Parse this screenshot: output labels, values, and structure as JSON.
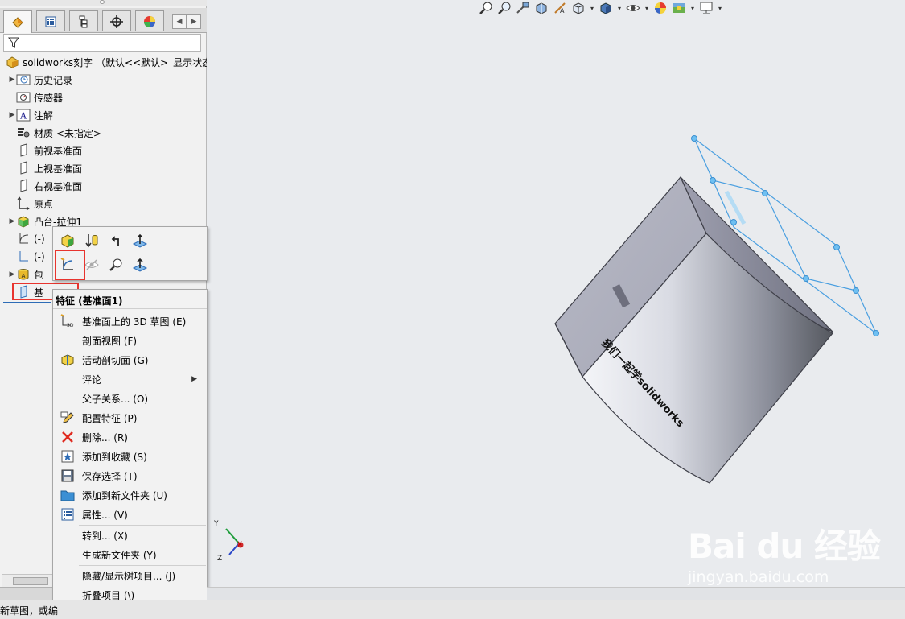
{
  "feature_tree": {
    "root_label": "solidworks刻字 （默认<<默认>_显示状态",
    "items": [
      {
        "label": "历史记录",
        "icon": "history-icon",
        "expandable": true
      },
      {
        "label": "传感器",
        "icon": "sensor-icon",
        "expandable": false
      },
      {
        "label": "注解",
        "icon": "annotation-icon",
        "expandable": true
      },
      {
        "label": "材质 <未指定>",
        "icon": "material-icon",
        "expandable": false
      },
      {
        "label": "前视基准面",
        "icon": "plane-icon",
        "expandable": false
      },
      {
        "label": "上视基准面",
        "icon": "plane-icon",
        "expandable": false
      },
      {
        "label": "右视基准面",
        "icon": "plane-icon",
        "expandable": false
      },
      {
        "label": "原点",
        "icon": "origin-icon",
        "expandable": false
      },
      {
        "label": "凸台-拉伸1",
        "icon": "boss-extrude-icon",
        "expandable": true
      },
      {
        "label": "(-)",
        "icon": "sketch-icon",
        "expandable": false
      },
      {
        "label": "(-)",
        "icon": "sketch-icon",
        "expandable": false
      },
      {
        "label": "包",
        "icon": "wrap-icon",
        "expandable": true
      },
      {
        "label": "基",
        "icon": "plane-icon",
        "expandable": false
      }
    ]
  },
  "context_menu": {
    "header": "特征 (基准面1)",
    "items": [
      {
        "label": "基准面上的 3D 草图 (E)",
        "icon": "3d-sketch-icon"
      },
      {
        "label": "剖面视图 (F)",
        "icon": ""
      },
      {
        "label": "活动剖切面 (G)",
        "icon": "section-plane-icon"
      },
      {
        "label": "评论",
        "icon": "",
        "submenu": true
      },
      {
        "label": "父子关系... (O)",
        "icon": ""
      },
      {
        "label": "配置特征 (P)",
        "icon": "pencil-icon"
      },
      {
        "label": "删除... (R)",
        "icon": "delete-icon"
      },
      {
        "label": "添加到收藏 (S)",
        "icon": "favorite-icon"
      },
      {
        "label": "保存选择 (T)",
        "icon": "save-selection-icon"
      },
      {
        "label": "添加到新文件夹 (U)",
        "icon": "folder-icon"
      },
      {
        "label": "属性... (V)",
        "icon": "properties-icon"
      },
      {
        "label": "转到... (X)",
        "icon": ""
      },
      {
        "label": "生成新文件夹 (Y)",
        "icon": ""
      },
      {
        "label": "隐藏/显示树项目... (J)",
        "icon": ""
      },
      {
        "label": "折叠项目 (\\)",
        "icon": ""
      }
    ]
  },
  "model": {
    "engraved_text": "我们一起学solidworks"
  },
  "triad": {
    "x": "X",
    "y": "Y",
    "z": "Z"
  },
  "status_bar": {
    "text": "新草图，或编"
  },
  "watermark": {
    "logo": "Bai du 经验",
    "url": "jingyan.baidu.com"
  },
  "colors": {
    "accent_red": "#e8342e",
    "plane_blue": "#4a9fe0",
    "background": "#e9ebee"
  }
}
